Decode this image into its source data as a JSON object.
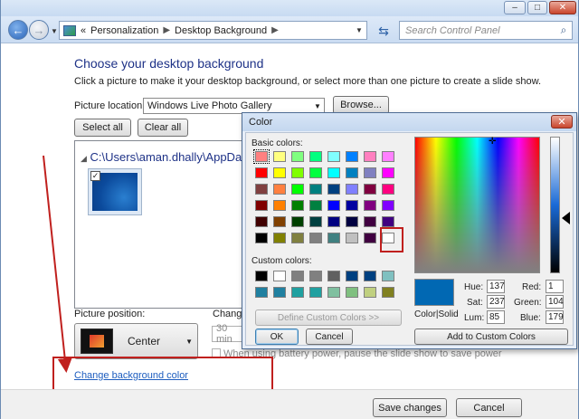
{
  "window": {
    "minimize": "–",
    "maximize": "□",
    "close": "✕"
  },
  "nav": {
    "history_chevron": "«",
    "breadcrumb": [
      "Personalization",
      "Desktop Background"
    ],
    "search_placeholder": "Search Control Panel"
  },
  "page": {
    "title": "Choose your desktop background",
    "description": "Click a picture to make it your desktop background, or select more than one picture to create a slide show.",
    "picture_location_label": "Picture location:",
    "picture_location_value": "Windows Live Photo Gallery",
    "browse_button": "Browse...",
    "select_all_button": "Select all",
    "clear_all_button": "Clear all",
    "folder_path": "C:\\Users\\aman.dhally\\AppData\\",
    "thumb_checked": "✓",
    "picture_position_label": "Picture position:",
    "picture_position_value": "Center",
    "change_picture_label": "Chang",
    "interval_value": "30 min",
    "battery_text": "When using battery power, pause the slide show to save power",
    "change_bg_color_link": "Change background color",
    "save_button": "Save changes",
    "cancel_button": "Cancel"
  },
  "color_dialog": {
    "title": "Color",
    "basic_colors_label": "Basic colors:",
    "custom_colors_label": "Custom colors:",
    "define_custom_button": "Define Custom Colors >>",
    "ok_button": "OK",
    "cancel_button": "Cancel",
    "color_solid_label": "Color|Solid",
    "add_custom_button": "Add to Custom Colors",
    "hue_label": "Hue:",
    "hue": "137",
    "sat_label": "Sat:",
    "sat": "237",
    "lum_label": "Lum:",
    "lum": "85",
    "red_label": "Red:",
    "red": "1",
    "green_label": "Green:",
    "green": "104",
    "blue_label": "Blue:",
    "blue": "179",
    "preview_color": "#0168b3",
    "basic_colors": [
      "#ff8080",
      "#ffff80",
      "#80ff80",
      "#00ff80",
      "#80ffff",
      "#0080ff",
      "#ff80c0",
      "#ff80ff",
      "#ff0000",
      "#ffff00",
      "#80ff00",
      "#00ff40",
      "#00ffff",
      "#0080c0",
      "#8080c0",
      "#ff00ff",
      "#804040",
      "#ff8040",
      "#00ff00",
      "#008080",
      "#004080",
      "#8080ff",
      "#800040",
      "#ff0080",
      "#800000",
      "#ff8000",
      "#008000",
      "#008040",
      "#0000ff",
      "#0000a0",
      "#800080",
      "#8000ff",
      "#400000",
      "#804000",
      "#004000",
      "#004040",
      "#000080",
      "#000040",
      "#400040",
      "#400080",
      "#000000",
      "#808000",
      "#808040",
      "#808080",
      "#408080",
      "#c0c0c0",
      "#400040",
      "#ffffff"
    ],
    "custom_colors": [
      "#000000",
      "#ffffff",
      "#808080",
      "#808080",
      "#606060",
      "#004080",
      "#004080",
      "#80c0c0",
      "#2080a0",
      "#2080a0",
      "#20a0a0",
      "#20a0a0",
      "#80c0a0",
      "#80c080",
      "#c0d080",
      "#808020"
    ]
  }
}
